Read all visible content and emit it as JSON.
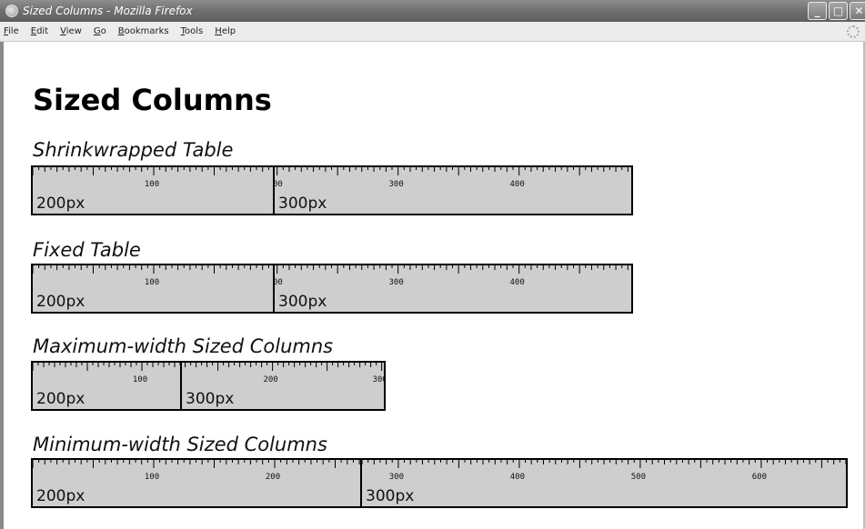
{
  "window": {
    "title": "Sized Columns - Mozilla Firefox",
    "controls": {
      "minimize": "_",
      "maximize": "□",
      "close": "✕"
    }
  },
  "menubar": {
    "items": [
      {
        "label": "File",
        "accel": "F",
        "rest": "ile"
      },
      {
        "label": "Edit",
        "accel": "E",
        "rest": "dit"
      },
      {
        "label": "View",
        "accel": "V",
        "rest": "iew"
      },
      {
        "label": "Go",
        "accel": "G",
        "rest": "o"
      },
      {
        "label": "Bookmarks",
        "accel": "B",
        "rest": "ookmarks"
      },
      {
        "label": "Tools",
        "accel": "T",
        "rest": "ools"
      },
      {
        "label": "Help",
        "accel": "H",
        "rest": "elp"
      }
    ]
  },
  "page": {
    "title": "Sized Columns",
    "sections": [
      {
        "heading": "Shrinkwrapped Table",
        "cells": [
          {
            "label": "200px"
          },
          {
            "label": "300px"
          }
        ]
      },
      {
        "heading": "Fixed Table",
        "cells": [
          {
            "label": "200px"
          },
          {
            "label": "300px"
          }
        ]
      },
      {
        "heading": "Maximum-width Sized Columns",
        "cells": [
          {
            "label": "200px"
          },
          {
            "label": "300px"
          }
        ]
      },
      {
        "heading": "Minimum-width Sized Columns",
        "cells": [
          {
            "label": "200px"
          },
          {
            "label": "300px"
          }
        ]
      }
    ]
  }
}
